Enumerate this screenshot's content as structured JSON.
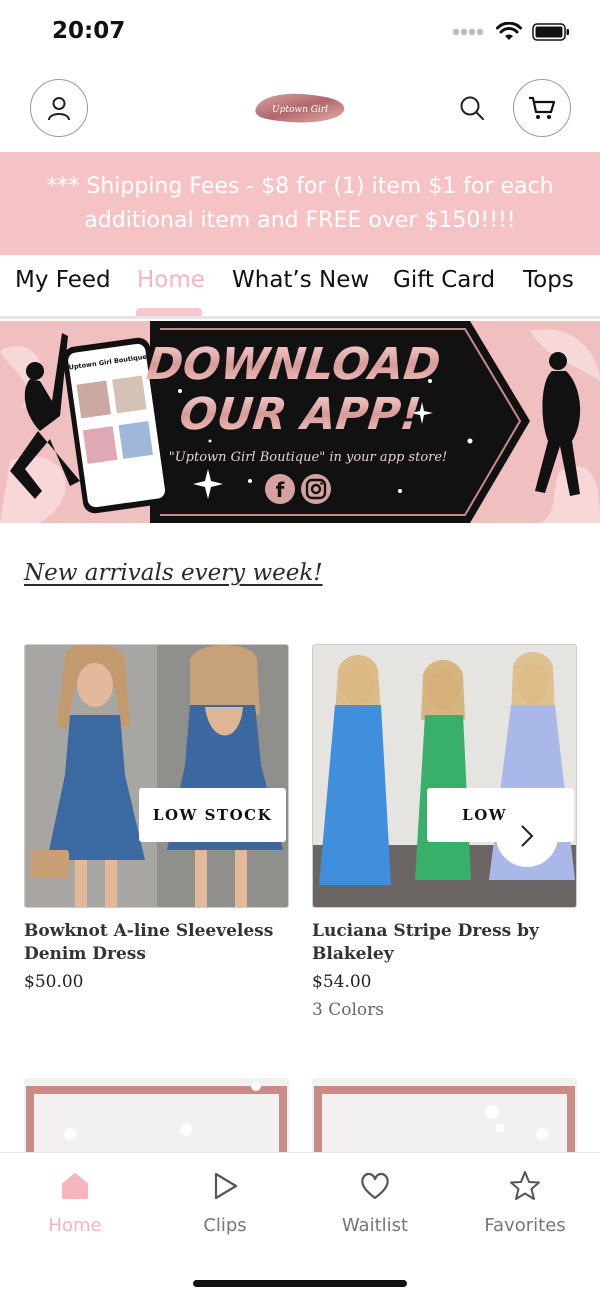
{
  "status": {
    "time": "20:07"
  },
  "header": {
    "logo_text": "Uptown Girl"
  },
  "promo": {
    "line1": "*** Shipping Fees - $8 for (1) item $1 for each",
    "line2": "additional item and FREE over $150!!!!"
  },
  "tabs": [
    {
      "label": "My Feed",
      "active": false
    },
    {
      "label": "Home",
      "active": true
    },
    {
      "label": "What’s New",
      "active": false
    },
    {
      "label": "Gift Card",
      "active": false
    },
    {
      "label": "Tops",
      "active": false
    }
  ],
  "hero": {
    "headline1": "DOWNLOAD",
    "headline2": "OUR APP!",
    "caption": "\"Uptown Girl Boutique\" in your app store!",
    "phone_title": "Uptown Girl Boutique"
  },
  "section": {
    "title": "New arrivals every week!"
  },
  "products": [
    {
      "name": "Bowknot A-line Sleeveless Denim Dress",
      "price": "$50.00",
      "badge": "LOW STOCK",
      "colors": ""
    },
    {
      "name": "Luciana Stripe Dress by Blakeley",
      "price": "$54.00",
      "badge": "LOW ST",
      "colors": "3 Colors"
    }
  ],
  "bottom_nav": [
    {
      "label": "Home",
      "icon": "home-icon",
      "active": true
    },
    {
      "label": "Clips",
      "icon": "play-icon",
      "active": false
    },
    {
      "label": "Waitlist",
      "icon": "heart-icon",
      "active": false
    },
    {
      "label": "Favorites",
      "icon": "star-icon",
      "active": false
    }
  ],
  "colors": {
    "accent_pink": "#f5b5bd",
    "banner_pink": "#f5c3c5"
  }
}
